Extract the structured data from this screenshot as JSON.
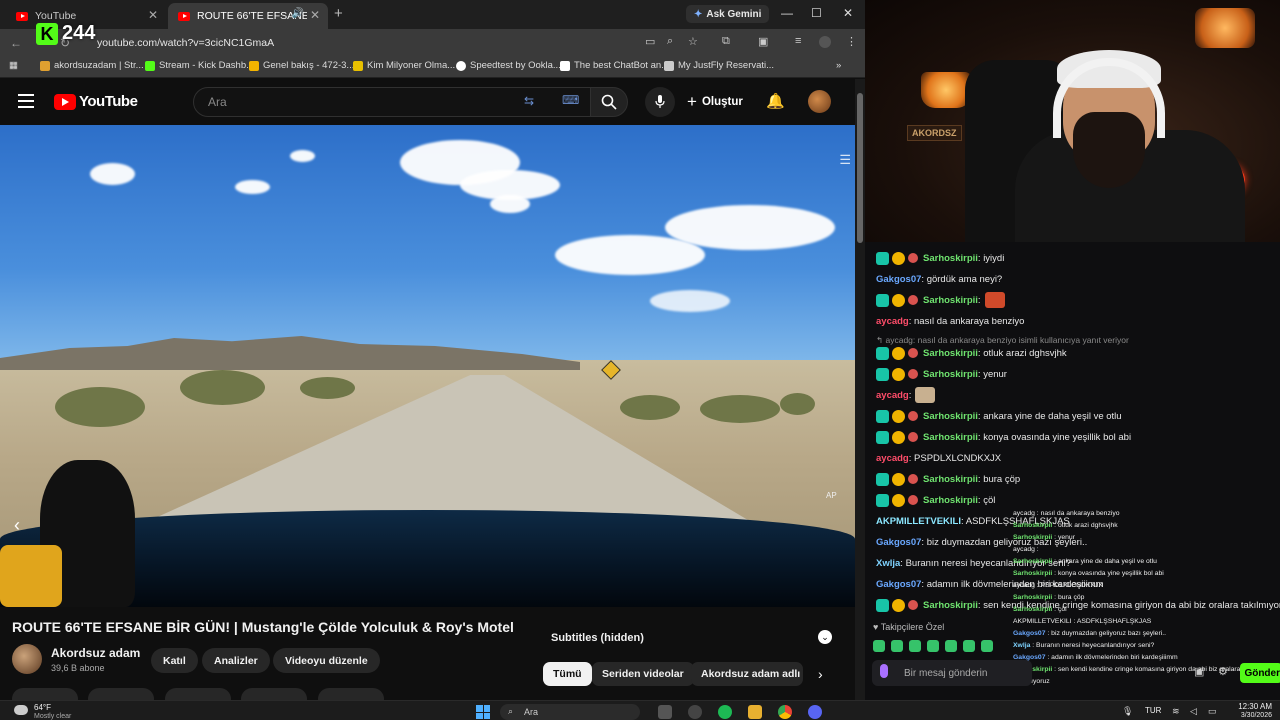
{
  "browser": {
    "tabs": [
      {
        "label": "YouTube",
        "active": false
      },
      {
        "label": "ROUTE 66'TE EFSANE BİR G",
        "active": true
      }
    ],
    "new_tab_icon": "plus-icon",
    "ask_gemini": "Ask Gemini",
    "window_controls": {
      "minimize": "—",
      "maximize": "☐",
      "close": "✕"
    },
    "url": "youtube.com/watch?v=3cicNC1GmaA",
    "kick_overlay": {
      "logo": "K",
      "count": "244"
    },
    "bookmarks": [
      {
        "label": "akordsuzadam | Str...",
        "color": "#e0a030"
      },
      {
        "label": "Stream - Kick Dashb...",
        "color": "#53fc18"
      },
      {
        "label": "Genel bakış - 472-3...",
        "color": "#f4b400"
      },
      {
        "label": "Kim Milyoner Olma...",
        "color": "#e8c000"
      },
      {
        "label": "Speedtest by Ookla...",
        "color": "#ffffff"
      },
      {
        "label": "The best ChatBot an...",
        "color": "#ffffff"
      },
      {
        "label": "My JustFly Reservati...",
        "color": "#cccccc"
      }
    ]
  },
  "youtube": {
    "logo_text": "YouTube",
    "search_placeholder": "Ara",
    "create_label": "Oluştur",
    "video": {
      "title": "ROUTE 66'TE EFSANE BİR GÜN! | Mustang'le Çölde Yolculuk & Roy's Motel",
      "player_label": "AP"
    },
    "channel": {
      "name": "Akordsuz adam",
      "subscribers": "39,6 B abone",
      "buttons": [
        "Katıl",
        "Analizler",
        "Videoyu düzenle"
      ]
    },
    "subtitles": {
      "label": "Subtitles (hidden)"
    },
    "chips": [
      {
        "label": "Tümü",
        "selected": true
      },
      {
        "label": "Seriden videolar",
        "selected": false
      },
      {
        "label": "Akordsuz adam adlı y",
        "selected": false
      }
    ]
  },
  "chat": {
    "messages": [
      {
        "user": "Sarhoskirpii",
        "type": "sar",
        "badges": true,
        "text": ": iyiydi",
        "emote": null
      },
      {
        "user": "Gakgos07",
        "type": "gak",
        "badges": false,
        "text": ": gördük ama neyi?",
        "emote": null
      },
      {
        "user": "Sarhoskirpii",
        "type": "sar",
        "badges": true,
        "text": ":",
        "emote": "#d04a2a"
      },
      {
        "user": "aycadg",
        "type": "ayc",
        "badges": false,
        "text": ": nasıl da ankaraya benziyo",
        "emote": null
      },
      {
        "user": "Sarhoskirpii",
        "type": "sar",
        "badges": true,
        "text": ": otluk arazi dghsvjhk",
        "emote": null
      },
      {
        "user": "Sarhoskirpii",
        "type": "sar",
        "badges": true,
        "text": ": yenur",
        "emote": null
      },
      {
        "user": "aycadg",
        "type": "ayc",
        "badges": false,
        "text": ":",
        "emote": "#c8b090"
      },
      {
        "user": "Sarhoskirpii",
        "type": "sar",
        "badges": true,
        "text": ": ankara yine de daha yeşil ve otlu",
        "emote": null
      },
      {
        "user": "Sarhoskirpii",
        "type": "sar",
        "badges": true,
        "text": ": konya ovasında yine yeşillik bol abi",
        "emote": null
      },
      {
        "user": "aycadg",
        "type": "ayc",
        "badges": false,
        "text": ": PSPDLXLCNDKXJX",
        "emote": null
      },
      {
        "user": "Sarhoskirpii",
        "type": "sar",
        "badges": true,
        "text": ": bura çöp",
        "emote": null
      },
      {
        "user": "Sarhoskirpii",
        "type": "sar",
        "badges": true,
        "text": ": çöl",
        "emote": null
      },
      {
        "user": "AKPMILLETVEKILI",
        "type": "akp",
        "badges": false,
        "text": ": ASDFKLŞSHAFLŞKJAS",
        "emote": null
      },
      {
        "user": "Gakgos07",
        "type": "gak",
        "badges": false,
        "text": ": biz duymazdan geliyoruz bazı şeyleri..",
        "emote": null
      },
      {
        "user": "Xwlja",
        "type": "xwi",
        "badges": false,
        "text": ": Buranın neresi heyecanlandırıyor seni?",
        "emote": null
      },
      {
        "user": "Gakgos07",
        "type": "gak",
        "badges": false,
        "text": ": adamın ilk dövmelerinden biri kardeşiiimm",
        "emote": null
      },
      {
        "user": "Sarhoskirpii",
        "type": "sar",
        "badges": true,
        "text": ": sen kendi kendine cringe komasına giriyon da abi biz oralara takılmıyoruz",
        "emote": null
      }
    ],
    "reply_notice": "↰ aycadg: nasıl da ankaraya benziyo isimli kullanıcıya yanıt veriyor",
    "followers_label": "Takipçilere Özel",
    "input_placeholder": "Bir mesaj gönderin",
    "send_label": "Gönder",
    "mini_overlay": [
      {
        "user": "",
        "text": "aycadg : nasıl da ankaraya benziyo"
      },
      {
        "user": "Sarhoskirpii",
        "text": " : otluk arazi dghsvjhk"
      },
      {
        "user": "Sarhoskirpii",
        "text": " : yenur"
      },
      {
        "user": "",
        "text": "aycadg :"
      },
      {
        "user": "Sarhoskirpii",
        "text": " : ankara yine de daha yeşil ve otlu"
      },
      {
        "user": "Sarhoskirpii",
        "text": " : konya ovasında yine yeşillik bol abi"
      },
      {
        "user": "",
        "text": "aycadg : PSPDLXLCNDKXJX"
      },
      {
        "user": "Sarhoskirpii",
        "text": " : bura çöp"
      },
      {
        "user": "Sarhoskirpii",
        "text": " : çöl"
      },
      {
        "user": "",
        "text": "AKPMILLETVEKILI : ASDFKLŞSHAFLŞKJAS"
      },
      {
        "user": "Gakgos07",
        "text": " : biz duymazdan geliyoruz bazı şeyleri.."
      },
      {
        "user": "Xwlja",
        "text": " : Buranın neresi heyecanlandırıyor seni?"
      },
      {
        "user": "Gakgos07",
        "text": " : adamın ilk dövmelerinden biri kardeşiiimm"
      },
      {
        "user": "Sarhoskirpii",
        "text": " : sen kendi kendine cringe komasına giriyon da abi biz oralara"
      },
      {
        "user": "",
        "text": "takılmıyoruz"
      }
    ]
  },
  "webcam": {
    "sign": "AKORDSZ"
  },
  "taskbar": {
    "weather_temp": "64°F",
    "weather_desc": "Mostly clear",
    "search_label": "Ara",
    "language": "TUR",
    "time": "12:30 AM",
    "date": "3/30/2026"
  }
}
